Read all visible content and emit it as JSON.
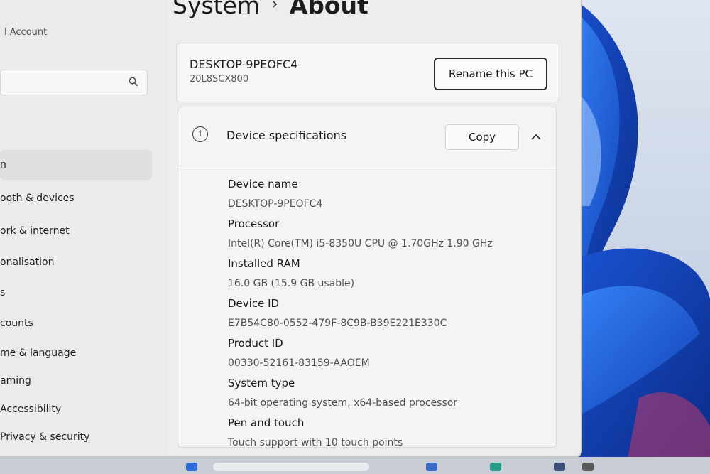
{
  "window": {
    "breadcrumb_parent": "System",
    "breadcrumb_separator": "›",
    "breadcrumb_current": "About"
  },
  "sidebar": {
    "account_label": "l Account",
    "search_placeholder": "",
    "items": [
      {
        "label": "n",
        "active": true
      },
      {
        "label": "ooth & devices"
      },
      {
        "label": "ork & internet"
      },
      {
        "label": "onalisation"
      },
      {
        "label": "s"
      },
      {
        "label": "counts"
      },
      {
        "label": "me & language"
      },
      {
        "label": "aming"
      },
      {
        "label": "Accessibility"
      },
      {
        "label": "Privacy & security"
      }
    ]
  },
  "device_card": {
    "pc_name": "DESKTOP-9PEOFC4",
    "pc_model": "20L8SCX800",
    "rename_label": "Rename this PC"
  },
  "specs": {
    "title": "Device specifications",
    "copy_label": "Copy",
    "rows": [
      {
        "label": "Device name",
        "value": "DESKTOP-9PEOFC4"
      },
      {
        "label": "Processor",
        "value": "Intel(R) Core(TM) i5-8350U CPU @ 1.70GHz   1.90 GHz"
      },
      {
        "label": "Installed RAM",
        "value": "16.0 GB (15.9 GB usable)"
      },
      {
        "label": "Device ID",
        "value": "E7B54C80-0552-479F-8C9B-B39E221E330C"
      },
      {
        "label": "Product ID",
        "value": "00330-52161-83159-AAOEM"
      },
      {
        "label": "System type",
        "value": "64-bit operating system, x64-based processor"
      },
      {
        "label": "Pen and touch",
        "value": "Touch support with 10 touch points"
      }
    ]
  },
  "icons": {
    "info": "info-icon",
    "search": "search-icon",
    "collapse": "chevron-up-icon"
  },
  "colors": {
    "window_bg": "#ededec",
    "card_bg": "#f4f4f3",
    "wallpaper_blue": "#1f5fd6"
  }
}
